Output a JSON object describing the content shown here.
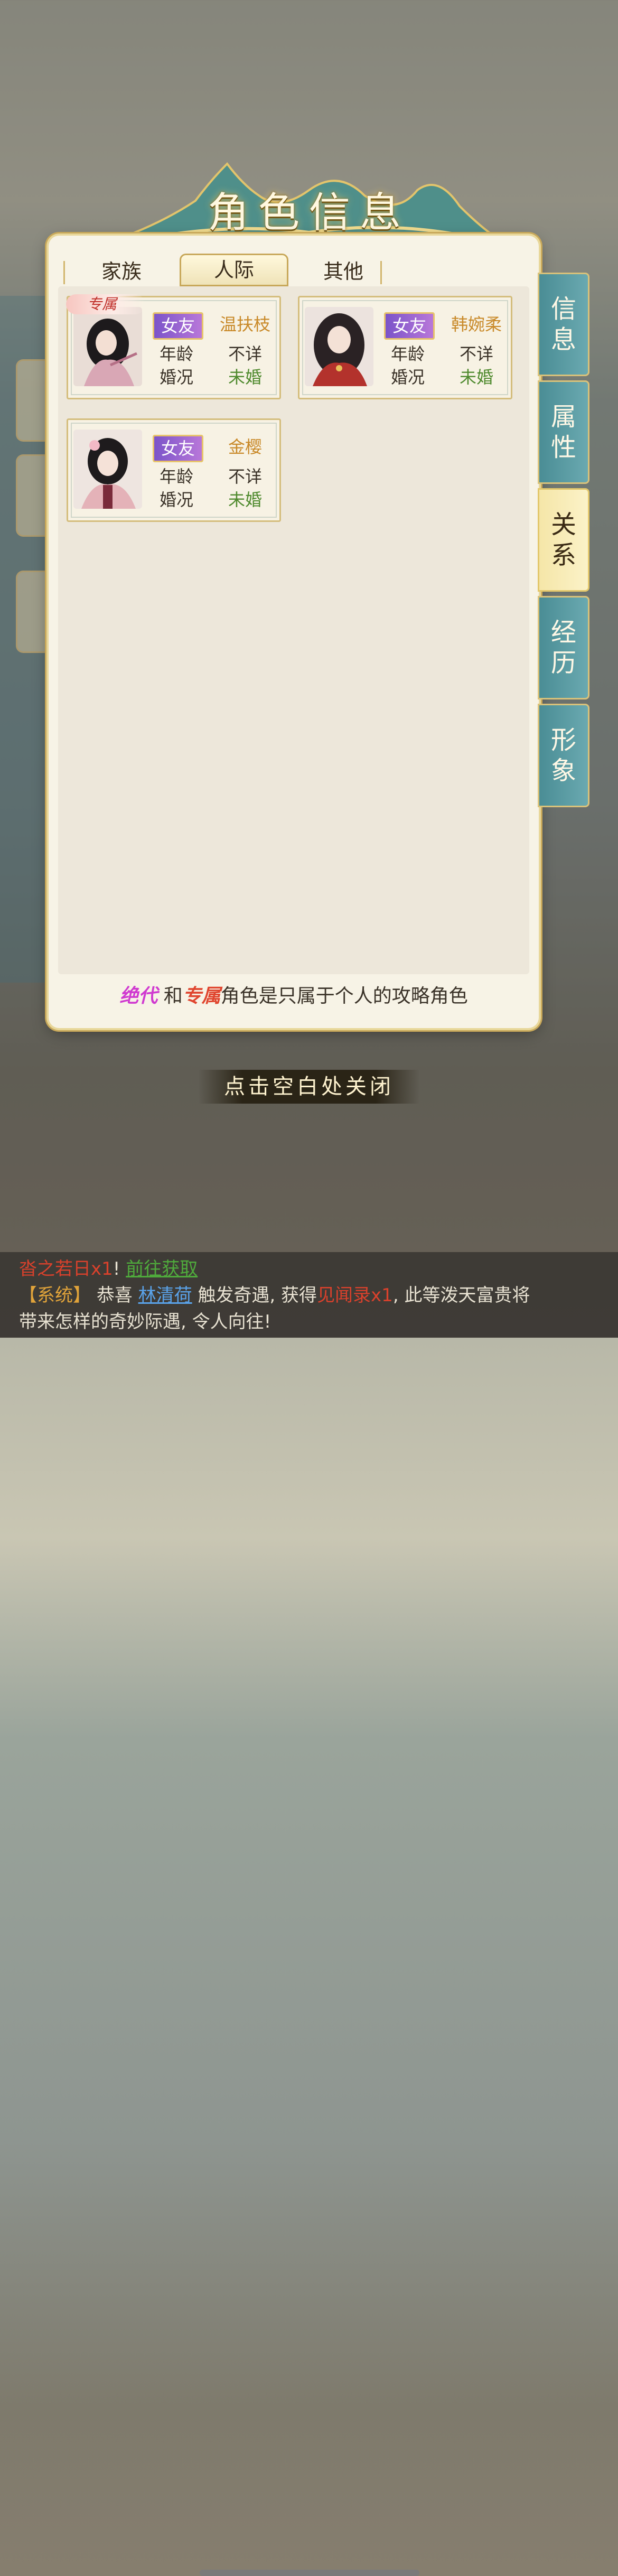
{
  "dialog": {
    "title": "角色信息",
    "tabs": [
      {
        "label": "家族",
        "active": false
      },
      {
        "label": "人际",
        "active": true
      },
      {
        "label": "其他",
        "active": false
      }
    ],
    "cards": [
      {
        "exclusive_badge": "专属",
        "relation": "女友",
        "name": "温扶枝",
        "age_label": "年龄",
        "age_value": "不详",
        "marital_label": "婚况",
        "marital_value": "未婚"
      },
      {
        "exclusive_badge": "",
        "relation": "女友",
        "name": "韩婉柔",
        "age_label": "年龄",
        "age_value": "不详",
        "marital_label": "婚况",
        "marital_value": "未婚"
      },
      {
        "exclusive_badge": "",
        "relation": "女友",
        "name": "金樱",
        "age_label": "年龄",
        "age_value": "不详",
        "marital_label": "婚况",
        "marital_value": "未婚"
      }
    ],
    "footer": {
      "keyword_1": "绝代",
      "connector": "和",
      "keyword_2": "专属",
      "text": "角色是只属于个人的攻略角色"
    }
  },
  "side_tabs": [
    {
      "label_1": "信",
      "label_2": "息",
      "active": false
    },
    {
      "label_1": "属",
      "label_2": "性",
      "active": false
    },
    {
      "label_1": "关",
      "label_2": "系",
      "active": true
    },
    {
      "label_1": "经",
      "label_2": "历",
      "active": false
    },
    {
      "label_1": "形",
      "label_2": "象",
      "active": false
    }
  ],
  "close_hint": "点击空白处关闭",
  "chat": {
    "line1_item": "沓之若日x1",
    "line1_suffix": "!",
    "line1_link": "前往获取",
    "line2_prefix": "【系统】",
    "line2_text1": "恭喜",
    "line2_player": "林清荷",
    "line2_text2": "触发奇遇, 获得",
    "line2_item": "见闻录x1",
    "line2_text3": ", 此等泼天富贵将",
    "line3_text": "带来怎样的奇妙际遇, 令人向往!"
  },
  "colors": {
    "panel_bg": "#f7f3e6",
    "gold_border": "#c8a85a",
    "teal_tab": "#4a8d95",
    "relation_purple": "#7b54c9",
    "name_gold": "#c98a2a",
    "single_green": "#4f8a2e"
  }
}
